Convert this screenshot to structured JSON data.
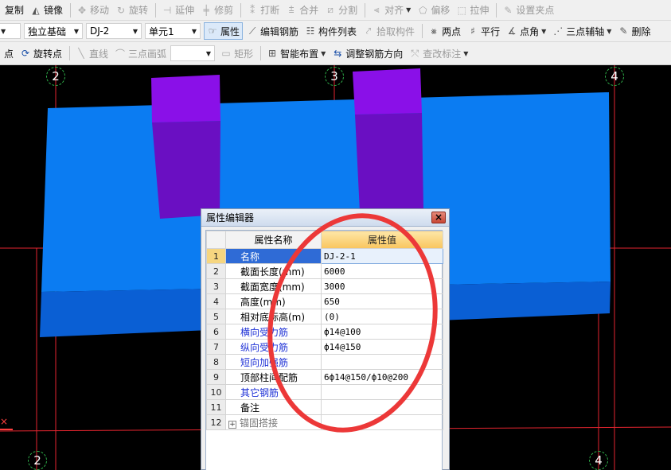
{
  "toolbar_row1": {
    "items": [
      {
        "label": "复制",
        "icon": "copy-icon",
        "enabled": true
      },
      {
        "label": "镜像",
        "icon": "mirror-icon",
        "enabled": true
      },
      {
        "label": "移动",
        "icon": "move-icon",
        "enabled": false
      },
      {
        "label": "旋转",
        "icon": "rotate-icon",
        "enabled": false
      },
      {
        "label": "延伸",
        "icon": "extend-icon",
        "enabled": false
      },
      {
        "label": "修剪",
        "icon": "trim-icon",
        "enabled": false
      },
      {
        "label": "打断",
        "icon": "break-icon",
        "enabled": false
      },
      {
        "label": "合并",
        "icon": "merge-icon",
        "enabled": false
      },
      {
        "label": "分割",
        "icon": "split-icon",
        "enabled": false
      },
      {
        "label": "对齐",
        "icon": "align-icon",
        "enabled": false
      },
      {
        "label": "偏移",
        "icon": "offset-icon",
        "enabled": false
      },
      {
        "label": "拉伸",
        "icon": "stretch-icon",
        "enabled": false
      },
      {
        "label": "设置夹点",
        "icon": "grip-icon",
        "enabled": false
      }
    ]
  },
  "toolbar_row2": {
    "combo_type": "独立基础",
    "combo_name": "DJ-2",
    "combo_unit": "单元1",
    "properties": "属性",
    "edit_rebar": "编辑钢筋",
    "component_list": "构件列表",
    "pick_component": "拾取构件",
    "two_points": "两点",
    "parallel": "平行",
    "point_angle": "点角",
    "three_point_aux": "三点辅轴",
    "delete": "删除"
  },
  "toolbar_row3": {
    "point": "点",
    "rotate_point": "旋转点",
    "line": "直线",
    "arc": "三点画弧",
    "rect": "矩形",
    "smart_layout": "智能布置",
    "adjust_rebar": "调整钢筋方向",
    "check_label": "查改标注"
  },
  "axis_labels": {
    "a": "2",
    "b": "3",
    "c": "4"
  },
  "colors": {
    "slab_top": "#0b7cf2",
    "slab_front": "#0a5fd4",
    "column_top": "#8a10e8",
    "column_front": "#6a0fc2",
    "grid": "#e4252f",
    "highlight_ellipse": "#ec3838"
  },
  "property_editor": {
    "title": "属性编辑器",
    "header_name": "属性名称",
    "header_value": "属性值",
    "rows": [
      {
        "no": "1",
        "name": "名称",
        "value": "DJ-2-1"
      },
      {
        "no": "2",
        "name": "截面长度(mm)",
        "value": "6000"
      },
      {
        "no": "3",
        "name": "截面宽度(mm)",
        "value": "3000"
      },
      {
        "no": "4",
        "name": "高度(mm)",
        "value": "650"
      },
      {
        "no": "5",
        "name": "相对底标高(m)",
        "value": "(0)"
      },
      {
        "no": "6",
        "name": "横向受力筋",
        "value": "ф14@100"
      },
      {
        "no": "7",
        "name": "纵向受力筋",
        "value": "ф14@150"
      },
      {
        "no": "8",
        "name": "短向加强筋",
        "value": ""
      },
      {
        "no": "9",
        "name": "顶部柱间配筋",
        "value": "6ф14@150/ф10@200"
      },
      {
        "no": "10",
        "name": "其它钢筋",
        "value": ""
      },
      {
        "no": "11",
        "name": "备注",
        "value": ""
      },
      {
        "no": "12",
        "name": "锚固搭接",
        "value": ""
      }
    ]
  }
}
